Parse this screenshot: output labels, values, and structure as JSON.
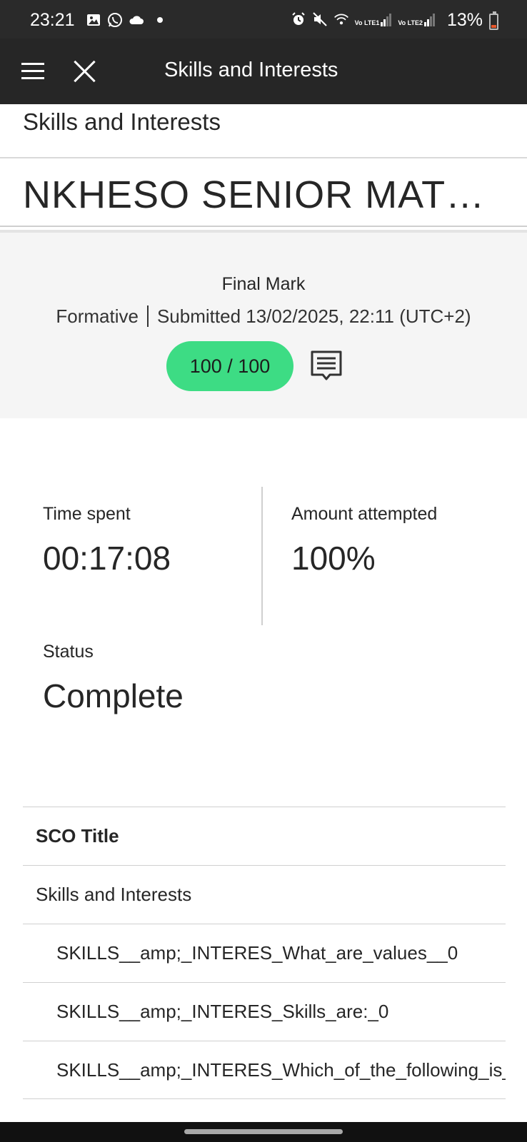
{
  "status_bar": {
    "time": "23:21",
    "battery": "13%",
    "sim1_label": "Vo LTE1",
    "sim2_label": "Vo LTE2",
    "icons_left": [
      "gallery-icon",
      "whatsapp-icon",
      "cloud-icon",
      "dot"
    ],
    "icons_right": [
      "alarm-icon",
      "mute-icon",
      "wifi-icon",
      "signal-icon",
      "signal-icon"
    ]
  },
  "app_bar": {
    "title": "Skills and Interests"
  },
  "subheader": {
    "title": "Skills and Interests"
  },
  "course": {
    "title": "NKHESO SENIOR MATHEMATICS"
  },
  "grade": {
    "label": "Final Mark",
    "type": "Formative",
    "submitted": "Submitted 13/02/2025, 22:11 (UTC+2)",
    "score": "100 / 100",
    "pill_color": "#3ddc84"
  },
  "stats": {
    "time_spent_label": "Time spent",
    "time_spent_value": "00:17:08",
    "attempted_label": "Amount attempted",
    "attempted_value": "100%",
    "status_label": "Status",
    "status_value": "Complete"
  },
  "table": {
    "header": "SCO Title",
    "rows": [
      "Skills and Interests",
      "SKILLS__amp;_INTERES_What_are_values__0",
      "SKILLS__amp;_INTERES_Skills_are:_0",
      "SKILLS__amp;_INTERES_Which_of_the_following_is_"
    ]
  }
}
